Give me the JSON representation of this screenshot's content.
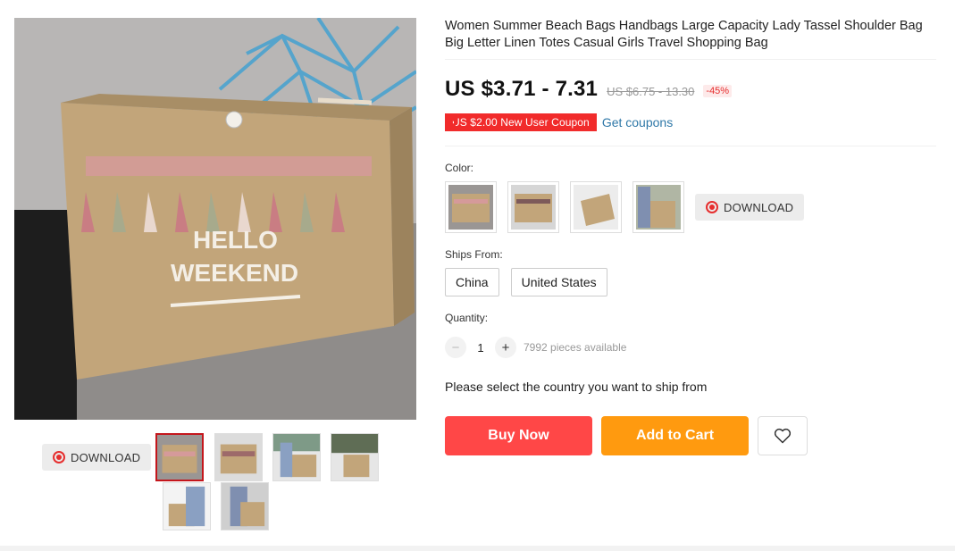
{
  "product": {
    "title": "Women Summer Beach Bags Handbags Large Capacity Lady Tassel Shoulder Bag Big Letter Linen Totes Casual Girls Travel Shopping Bag",
    "image_text_line1": "HELLO",
    "image_text_line2": "WEEKEND"
  },
  "gallery": {
    "download_label": "DOWNLOAD",
    "thumbnail_count": 6,
    "active_index": 0
  },
  "price": {
    "current": "US $3.71 - 7.31",
    "original": "US $6.75 - 13.30",
    "discount": "-45%"
  },
  "coupon": {
    "badge": "US $2.00 New User Coupon",
    "link": "Get coupons"
  },
  "color": {
    "label": "Color:",
    "download_label": "DOWNLOAD",
    "swatch_count": 4
  },
  "ships_from": {
    "label": "Ships From:",
    "options": [
      "China",
      "United States"
    ]
  },
  "quantity": {
    "label": "Quantity:",
    "minus": "−",
    "value": "1",
    "plus": "+",
    "available": "7992 pieces available"
  },
  "shipping_note": "Please select the country you want to ship from",
  "actions": {
    "buy_now": "Buy Now",
    "add_to_cart": "Add to Cart"
  },
  "colors": {
    "buy_now": "#ff4747",
    "add_to_cart": "#ff9a0f",
    "coupon": "#f12b2b",
    "link": "#2f78a8",
    "active_thumb_border": "#c4161c"
  },
  "icons": {
    "download": "target-icon",
    "wishlist": "heart-outline-icon"
  }
}
